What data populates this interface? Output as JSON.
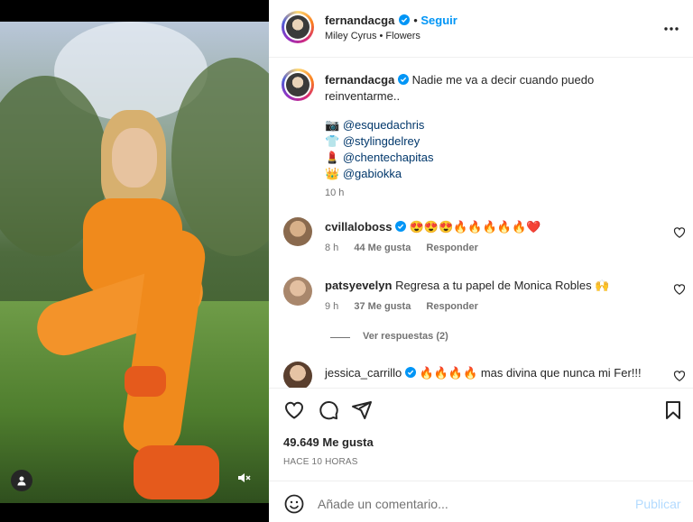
{
  "post": {
    "username": "fernandacga",
    "follow_label": "Seguir",
    "music": "Miley Cyrus • Flowers",
    "more_icon": "more-horizontal-icon"
  },
  "caption": {
    "username": "fernandacga",
    "text_line1": "Nadie me va a decir cuando puedo",
    "text_line2": "reinventarme..",
    "credits": [
      {
        "emoji": "📷",
        "handle": "@esquedachris"
      },
      {
        "emoji": "👕",
        "handle": "@stylingdelrey"
      },
      {
        "emoji": "💄",
        "handle": "@chentechapitas"
      },
      {
        "emoji": "👑",
        "handle": "@gabiokka"
      }
    ],
    "time": "10 h"
  },
  "comments": [
    {
      "username": "cvillaloboss",
      "verified": true,
      "text": "😍😍😍🔥🔥🔥🔥🔥❤️",
      "time": "8 h",
      "likes": "44 Me gusta",
      "reply": "Responder"
    },
    {
      "username": "patsyevelyn",
      "verified": false,
      "text": "Regresa a tu papel de Monica Robles 🙌",
      "time": "9 h",
      "likes": "37 Me gusta",
      "reply": "Responder"
    },
    {
      "username": "jessica_carrillo",
      "verified": true,
      "text": "🔥🔥🔥🔥 mas divina que nunca mi Fer!!!"
    }
  ],
  "view_replies": "Ver respuestas (2)",
  "stats": {
    "likes": "49.649 Me gusta",
    "posted": "HACE 10 HORAS"
  },
  "composer": {
    "placeholder": "Añade un comentario...",
    "publish_label": "Publicar"
  },
  "colors": {
    "accent": "#0095f6",
    "verified": "#0095f6",
    "muted": "#737373"
  }
}
